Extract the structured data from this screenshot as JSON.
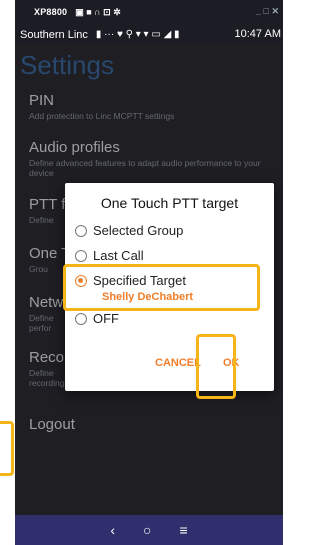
{
  "titlebar": {
    "title": "XP8800",
    "icons": "▣ ■ ∩ ⊡ ✲",
    "window_controls": "_ □ ✕"
  },
  "statusbar": {
    "carrier": "Southern Linc",
    "icons": "▮ ··· ♥ ⚲ ▾ ▾ ▭ ◢ ▮",
    "time": "10:47 AM"
  },
  "appbar": {
    "title": "Settings"
  },
  "settings": [
    {
      "title": "PIN",
      "subtitle": "Add protection to Linc MCPTT settings"
    },
    {
      "title": "Audio profiles",
      "subtitle": "Define advanced features to adapt audio performance to your device"
    },
    {
      "title": "PTT f",
      "subtitle": "Define"
    },
    {
      "title": "One T",
      "subtitle": "Grou"
    },
    {
      "title": "Netw",
      "subtitle": "Define perfor"
    },
    {
      "title": "Reco",
      "subtitle": "Define recordings"
    },
    {
      "title": "Logout",
      "subtitle": ""
    }
  ],
  "dialog": {
    "title": "One Touch PTT target",
    "options": [
      {
        "label": "Selected Group",
        "selected": false
      },
      {
        "label": "Last Call",
        "selected": false
      },
      {
        "label": "Specified Target",
        "selected": true
      },
      {
        "label": "OFF",
        "selected": false
      }
    ],
    "selected_target": "Shelly DeChabert",
    "cancel_label": "CANCEL",
    "ok_label": "OK"
  },
  "navbar": {
    "back": "‹",
    "home": "○",
    "menu": "≡"
  },
  "colors": {
    "accent": "#f07e2a",
    "highlight": "#f5b418",
    "background": "#2e2e36",
    "title": "#3f6fa8",
    "navbar": "#2f2f6e"
  }
}
